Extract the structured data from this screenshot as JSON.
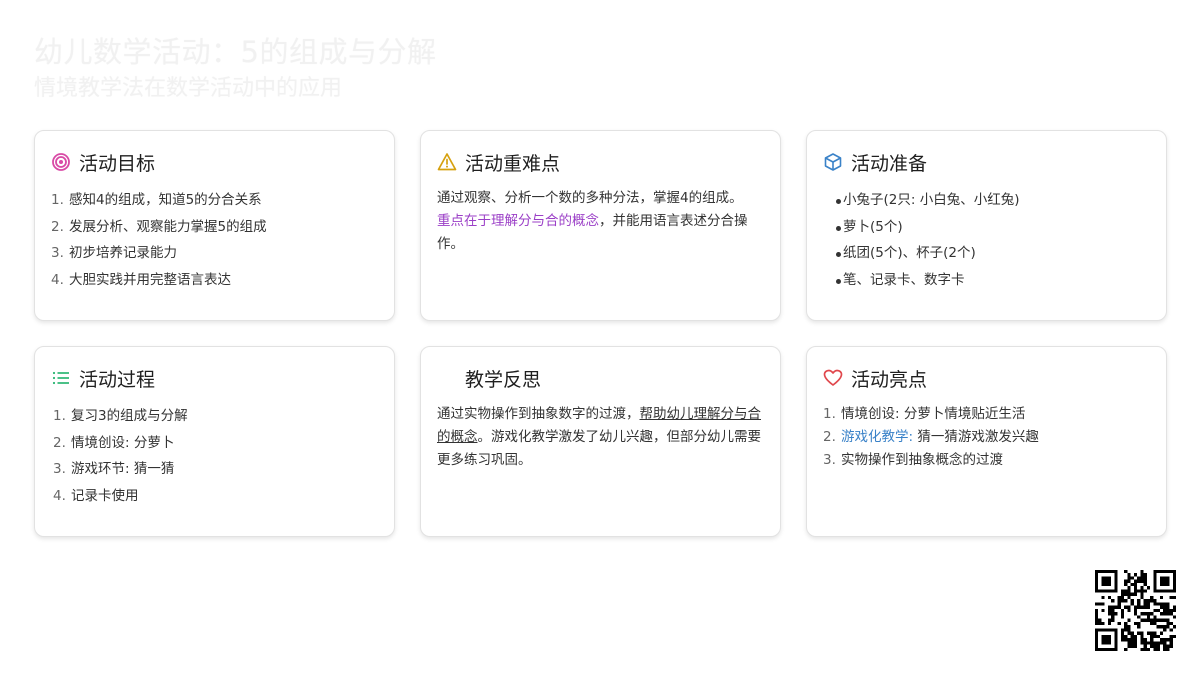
{
  "header": {
    "title": "幼儿数学活动：5的组成与分解",
    "subtitle": "情境教学法在数学活动中的应用"
  },
  "cards": {
    "goals": {
      "icon": "target-icon",
      "title": "活动目标",
      "items": [
        "感知4的组成，知道5的分合关系",
        "发展分析、观察能力掌握5的组成",
        "初步培养记录能力",
        "大胆实践并用完整语言表达"
      ]
    },
    "difficulty": {
      "icon": "warning-icon",
      "title": "活动重难点",
      "text1": "通过观察、分析一个数的多种分法，掌握4的组成。",
      "highlight": "重点在于理解分与合的概念",
      "text2": "，并能用语言表述分合操作。"
    },
    "prep": {
      "icon": "cube-icon",
      "title": "活动准备",
      "items": [
        "小兔子(2只: 小白兔、小红兔)",
        "萝卜(5个)",
        "纸团(5个)、杯子(2个)",
        "笔、记录卡、数字卡"
      ]
    },
    "process": {
      "icon": "list-icon",
      "title": "活动过程",
      "items": [
        "复习3的组成与分解",
        "情境创设: 分萝卜",
        "游戏环节: 猜一猜",
        "记录卡使用"
      ]
    },
    "reflection": {
      "title": "教学反思",
      "text1": "通过实物操作到抽象数字的过渡，",
      "underlined": "帮助幼儿理解分与合的概念",
      "text2": "。游戏化教学激发了幼儿兴趣，但部分幼儿需要更多练习巩固。"
    },
    "highlights": {
      "icon": "heart-icon",
      "title": "活动亮点",
      "item1": "情境创设: 分萝卜情境贴近生活",
      "item2_blue": "游戏化教学:",
      "item2_rest": " 猜一猜游戏激发兴趣",
      "item3": "实物操作到抽象概念的过渡"
    }
  },
  "colors": {
    "target": "#d94aa6",
    "warning": "#d6a10f",
    "cube": "#3a82c8",
    "list": "#2bb673",
    "heart": "#e0474c",
    "purple": "#9b3fc7",
    "blue": "#3a82c8"
  }
}
